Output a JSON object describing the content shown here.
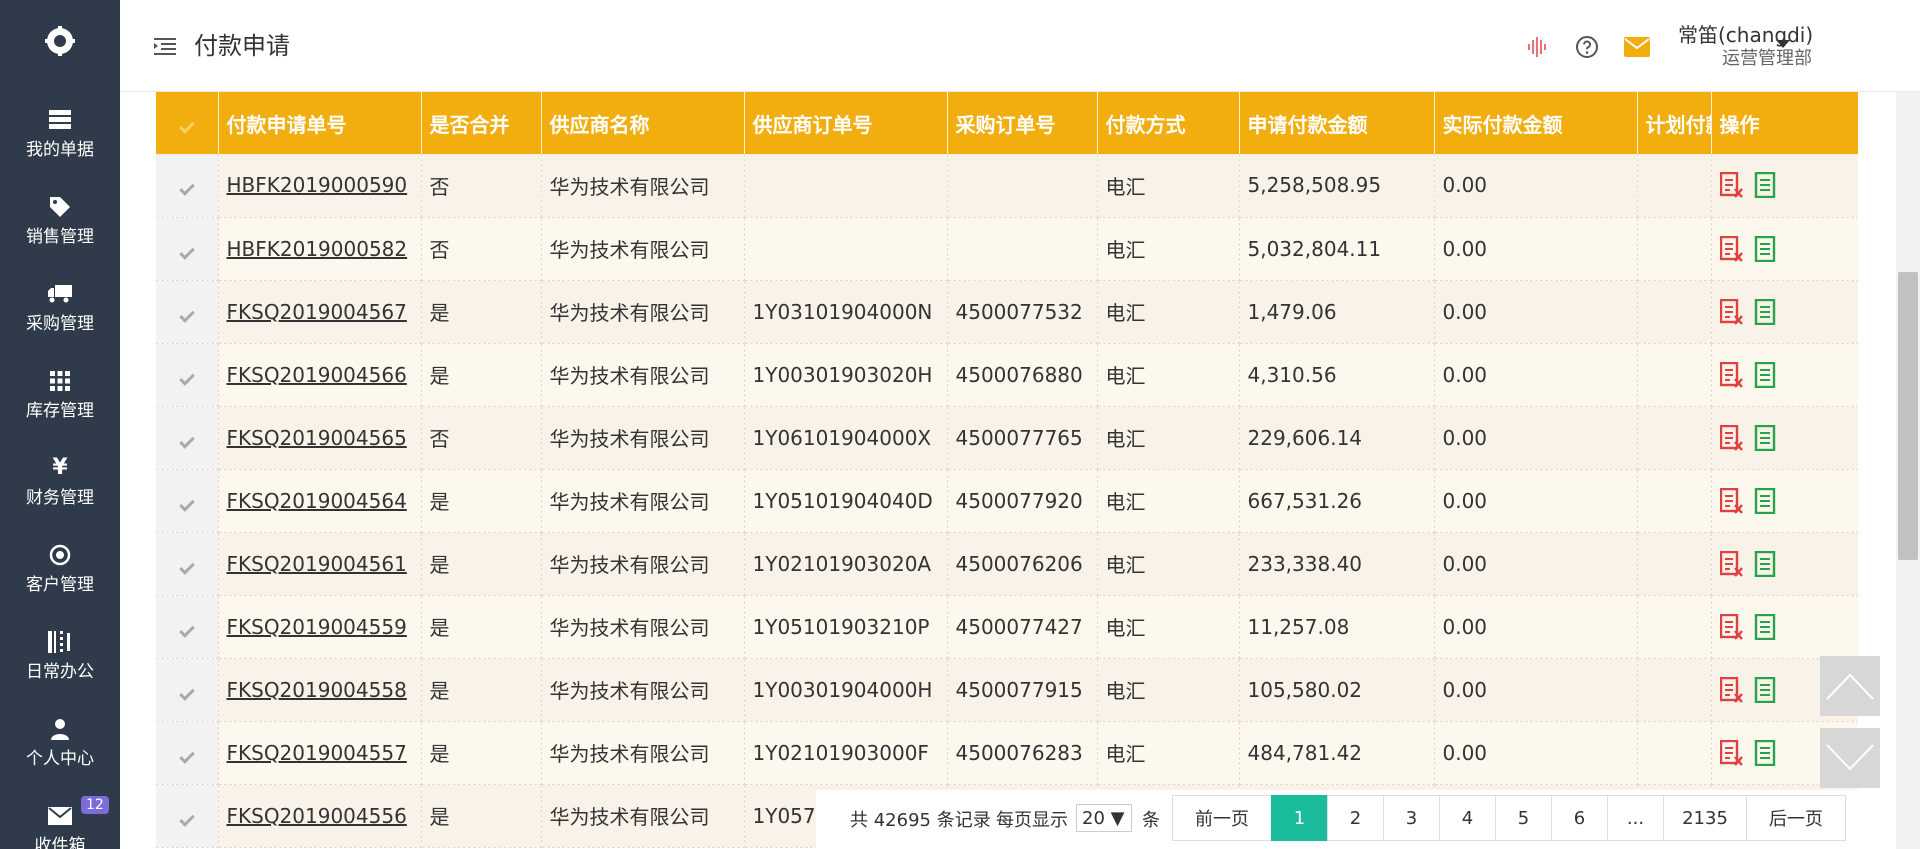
{
  "sidebar": {
    "logo_icon": "logo-icon",
    "items": [
      {
        "label": "我的单据",
        "icon": "document-list-icon"
      },
      {
        "label": "销售管理",
        "icon": "tag-icon"
      },
      {
        "label": "采购管理",
        "icon": "truck-icon"
      },
      {
        "label": "库存管理",
        "icon": "grid-icon"
      },
      {
        "label": "财务管理",
        "icon": "yen-icon"
      },
      {
        "label": "客户管理",
        "icon": "target-icon"
      },
      {
        "label": "日常办公",
        "icon": "office-icon"
      },
      {
        "label": "个人中心",
        "icon": "user-icon"
      },
      {
        "label": "收件箱",
        "icon": "mail-icon",
        "badge": "12"
      }
    ]
  },
  "header": {
    "title": "付款申请",
    "user_name": "常笛(changdi)",
    "user_dept": "运营管理部"
  },
  "colors": {
    "sidebar_bg": "#2f3b4a",
    "header_accent": "#f2ae0f",
    "pager_active": "#1bbc9b",
    "icon_red": "#e04040",
    "icon_green": "#27a34a"
  },
  "table": {
    "columns": [
      "付款申请单号",
      "是否合并",
      "供应商名称",
      "供应商订单号",
      "采购订单号",
      "付款方式",
      "申请付款金额",
      "实际付款金额",
      "计划付款",
      "操作"
    ],
    "rows": [
      {
        "id": "HBFK2019000590",
        "merged": "否",
        "supplier": "华为技术有限公司",
        "supplier_order": "",
        "po": "",
        "method": "电汇",
        "amount": "5,258,508.95",
        "actual": "0.00"
      },
      {
        "id": "HBFK2019000582",
        "merged": "否",
        "supplier": "华为技术有限公司",
        "supplier_order": "",
        "po": "",
        "method": "电汇",
        "amount": "5,032,804.11",
        "actual": "0.00"
      },
      {
        "id": "FKSQ2019004567",
        "merged": "是",
        "supplier": "华为技术有限公司",
        "supplier_order": "1Y03101904000N",
        "po": "4500077532",
        "method": "电汇",
        "amount": "1,479.06",
        "actual": "0.00"
      },
      {
        "id": "FKSQ2019004566",
        "merged": "是",
        "supplier": "华为技术有限公司",
        "supplier_order": "1Y00301903020H",
        "po": "4500076880",
        "method": "电汇",
        "amount": "4,310.56",
        "actual": "0.00"
      },
      {
        "id": "FKSQ2019004565",
        "merged": "否",
        "supplier": "华为技术有限公司",
        "supplier_order": "1Y06101904000X",
        "po": "4500077765",
        "method": "电汇",
        "amount": "229,606.14",
        "actual": "0.00"
      },
      {
        "id": "FKSQ2019004564",
        "merged": "是",
        "supplier": "华为技术有限公司",
        "supplier_order": "1Y05101904040D",
        "po": "4500077920",
        "method": "电汇",
        "amount": "667,531.26",
        "actual": "0.00"
      },
      {
        "id": "FKSQ2019004561",
        "merged": "是",
        "supplier": "华为技术有限公司",
        "supplier_order": "1Y02101903020A",
        "po": "4500076206",
        "method": "电汇",
        "amount": "233,338.40",
        "actual": "0.00"
      },
      {
        "id": "FKSQ2019004559",
        "merged": "是",
        "supplier": "华为技术有限公司",
        "supplier_order": "1Y05101903210P",
        "po": "4500077427",
        "method": "电汇",
        "amount": "11,257.08",
        "actual": "0.00"
      },
      {
        "id": "FKSQ2019004558",
        "merged": "是",
        "supplier": "华为技术有限公司",
        "supplier_order": "1Y00301904000H",
        "po": "4500077915",
        "method": "电汇",
        "amount": "105,580.02",
        "actual": "0.00"
      },
      {
        "id": "FKSQ2019004557",
        "merged": "是",
        "supplier": "华为技术有限公司",
        "supplier_order": "1Y02101903000F",
        "po": "4500076283",
        "method": "电汇",
        "amount": "484,781.42",
        "actual": "0.00"
      },
      {
        "id": "FKSQ2019004556",
        "merged": "是",
        "supplier": "华为技术有限公司",
        "supplier_order": "1Y057",
        "po": "",
        "method": "",
        "amount": "",
        "actual": ""
      }
    ]
  },
  "pager": {
    "total_prefix": "共",
    "total_count": "42695",
    "total_suffix": "条记录",
    "per_page_label": "每页显示",
    "per_page_value": "20 ▼",
    "per_page_unit": "条",
    "prev": "前一页",
    "pages": [
      "1",
      "2",
      "3",
      "4",
      "5",
      "6",
      "...",
      "2135"
    ],
    "active_page": "1",
    "next": "后一页"
  }
}
